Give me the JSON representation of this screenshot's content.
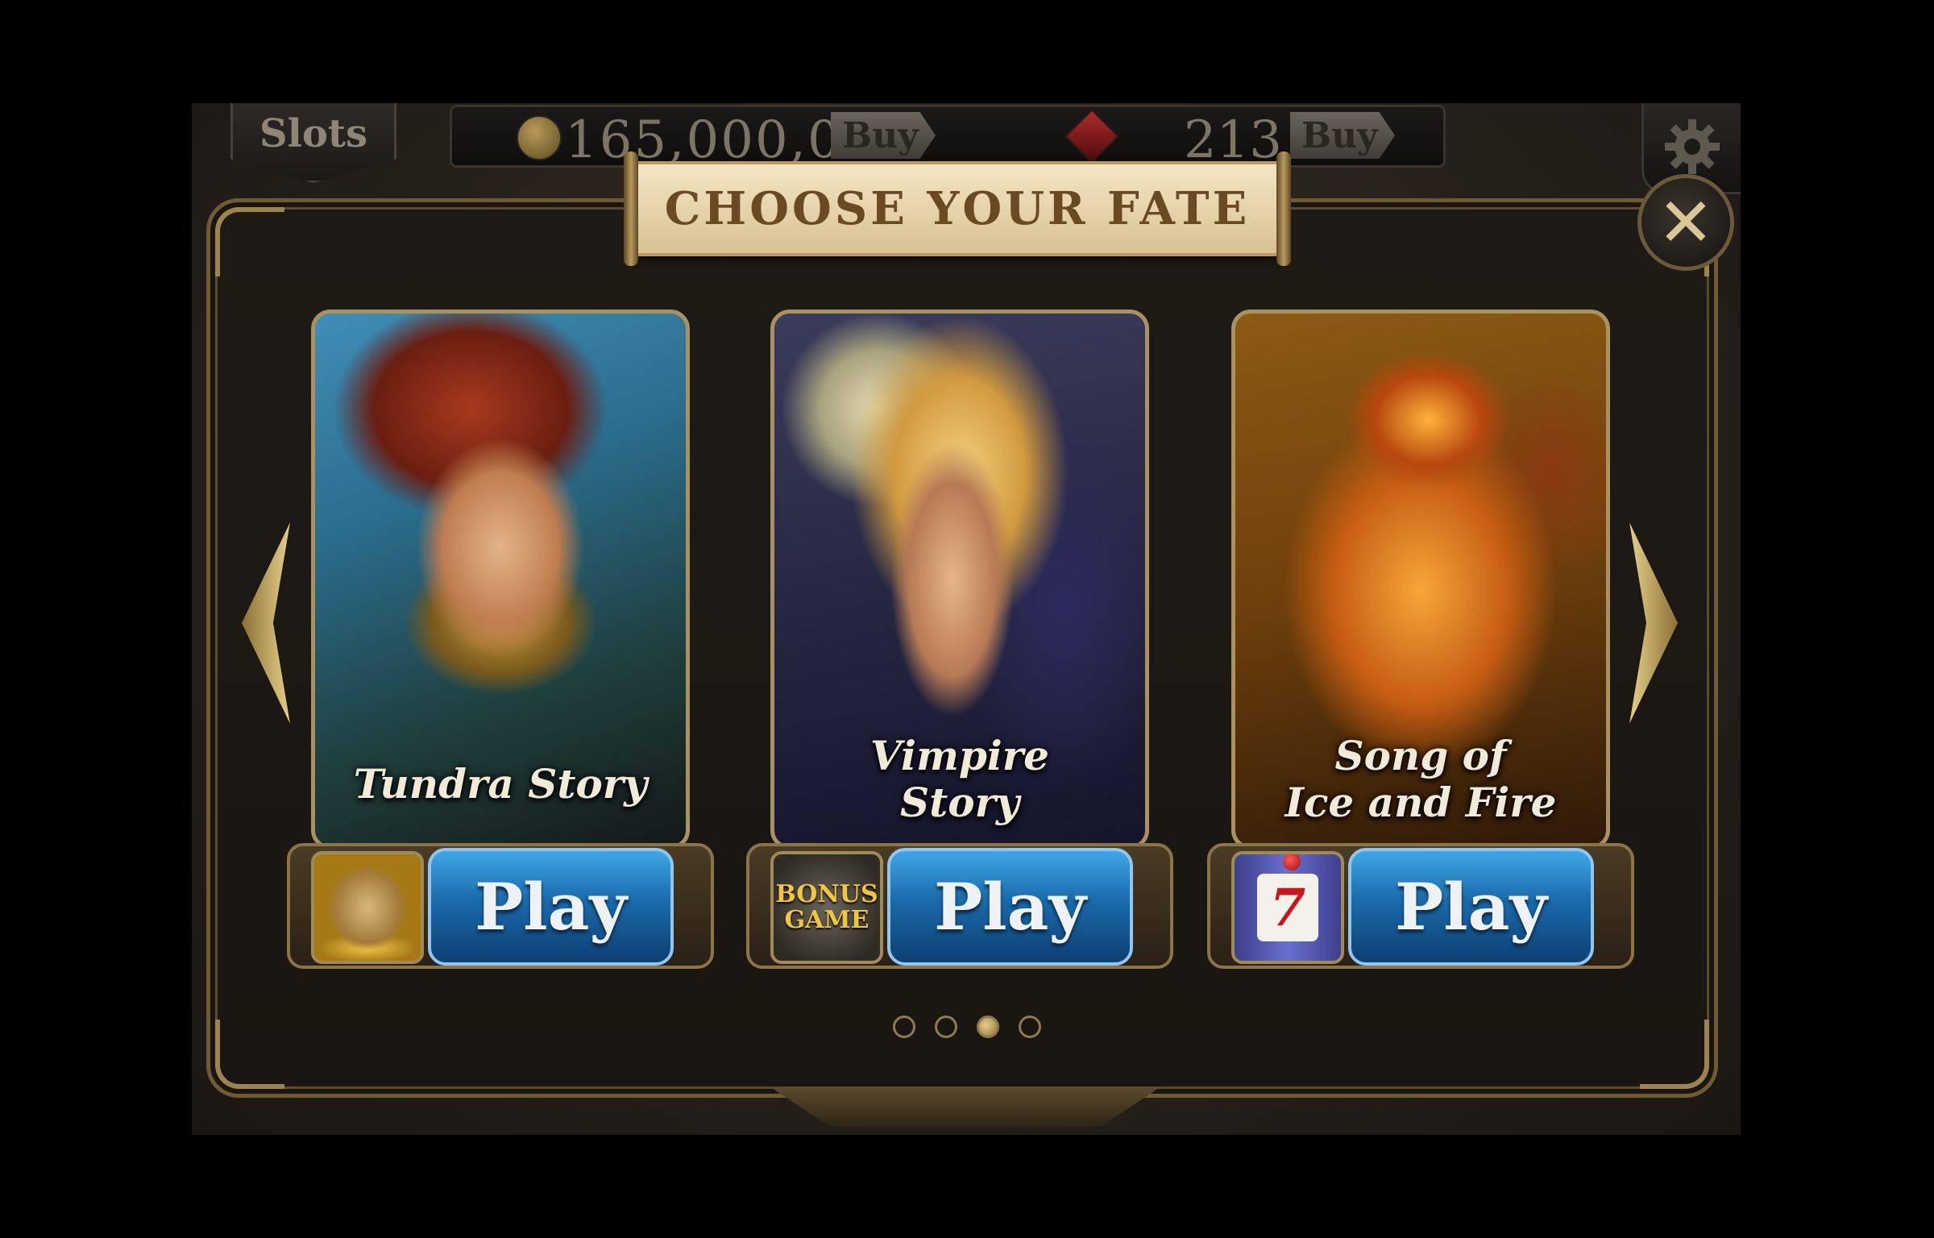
{
  "header": {
    "tab_label": "Slots",
    "coins": "165,000,000",
    "coins_buy_label": "Buy",
    "gems": "213",
    "gems_buy_label": "Buy"
  },
  "dialog": {
    "title": "CHOOSE YOUR FATE",
    "close_icon": "close-icon"
  },
  "games": [
    {
      "title_line1": "Tundra Story",
      "title_line2": "",
      "feature_icon": "gold-sack-icon",
      "play_label": "Play"
    },
    {
      "title_line1": "Vimpire",
      "title_line2": "Story",
      "feature_icon": "bonus-game-icon",
      "feature_text_1": "BONUS",
      "feature_text_2": "GAME",
      "play_label": "Play"
    },
    {
      "title_line1": "Song of",
      "title_line2": "Ice and Fire",
      "feature_icon": "slot-machine-icon",
      "feature_text": "7",
      "play_label": "Play"
    }
  ],
  "pagination": {
    "total": 4,
    "active_index": 2
  },
  "colors": {
    "accent_gold": "#c9ad6a",
    "play_blue": "#1a6aaa",
    "panel_bg": "#1e1a15"
  }
}
